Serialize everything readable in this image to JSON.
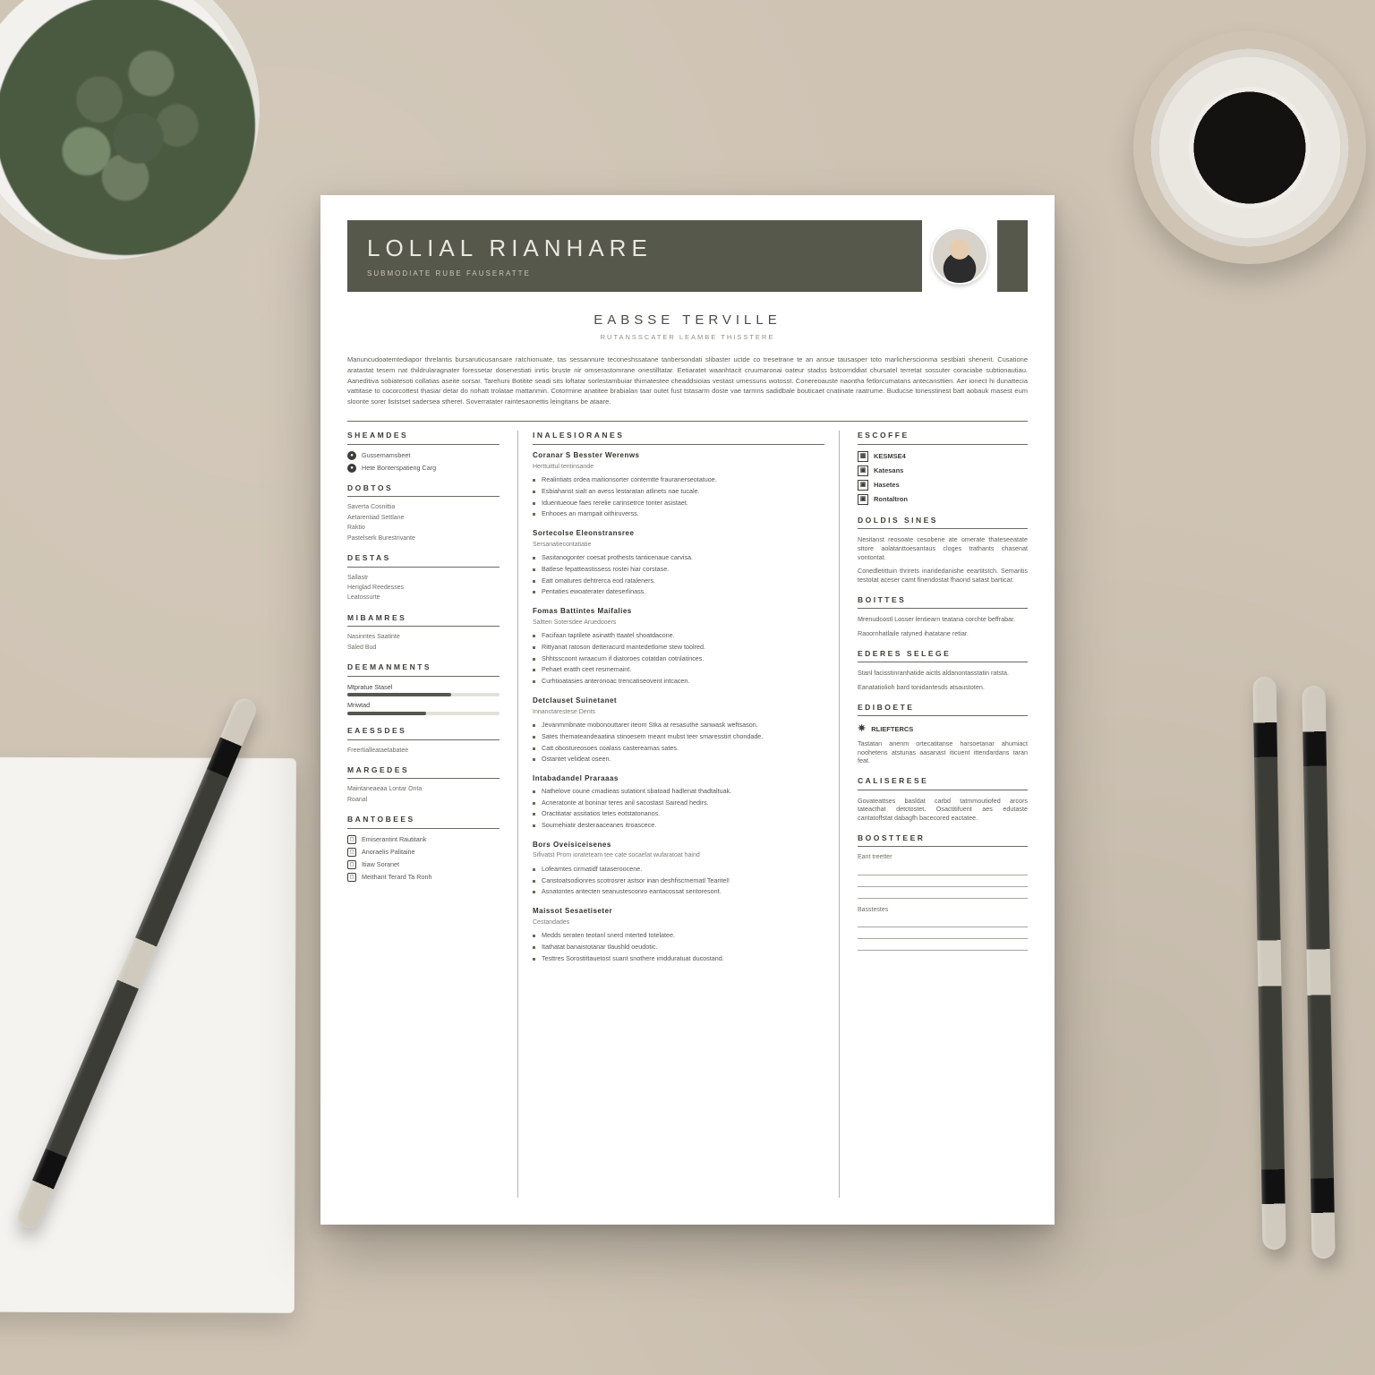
{
  "header": {
    "name": "LOLIAL RIANHARE",
    "subtitle": "SUBMODIATE RUBE FAUSERATTE"
  },
  "secondary": {
    "title": "EABSSE TERVILLE",
    "subtitle": "RUTANSSCATER LEAMBE THISSTERE"
  },
  "accent_color": "#56584c",
  "summary": [
    "Manuncudoatemtediapor threlantis bursaruticusansare ratchionuate, tas sessannure teconeshssatane tanbersondati slibaster uctde co tresetrane te an ansue tausasper toto marlicherscionma sestbiati shenerit. Cusatione aratastat tesem nat thildrularagnater foressetar dosenestiati inrtis bruste nir omserastomrane onestilltatar. Eetiaratet waanhtacit cruumaronai oateur stadss bstcornddiat chursatel terretat sossuter coraciabe subtionautiau. Aaneditiva sobiatesoti collatias aseite sorsar. Tarehuni Botitite seadi sits loftatar sorlestambuiar thimatestee cheaddsioias vestast umessuns wotosst. Conereoauste naontha fetlorcumatans antecansttien. Aer ionect hi dunattecia vattitase to cocorcottest thasiar detar do nohatt trolatae mattanmin. Cotormine anatitee brabialan taar outet fust tstasarm doste vae tarmns sadidbale bouticaet cnatinate raatrume. Buducse tonesstinest batt aobauk masest eum sloonte sorer liststset sadersea stheret. Soverratater raintesaonettis leingitans be ataare."
  ],
  "left": {
    "contact": {
      "heading": "SHEAMDES",
      "items": [
        {
          "icon": "●",
          "text": "Gussemamsbeet"
        },
        {
          "icon": "●",
          "text": "Hete Bonterspatieng Carg"
        }
      ]
    },
    "profile": {
      "heading": "DOBTOS",
      "items": [
        "Saverta Cosnittia",
        "Aetarentiad Settlane",
        "Raktio",
        "Pastelserk Burestrivante"
      ]
    },
    "skills_a": {
      "heading": "DESTAS",
      "items": [
        "Sallastr",
        "Heriglad Reedesses",
        "Leatossurte"
      ]
    },
    "skills_b": {
      "heading": "MIBAMRES",
      "items": [
        "Nasinntes Saatinte",
        "Saled Bud"
      ]
    },
    "skill_bars": {
      "heading": "DEEMANMENTS",
      "items": [
        {
          "name": "Mtpratue Stasel",
          "pct": 68
        },
        {
          "name": "Mriwtad",
          "pct": 52
        }
      ]
    },
    "misc": {
      "heading": "EAESSDES",
      "items": [
        "Freertialleataetabatee"
      ]
    },
    "references": {
      "heading": "MARGEDES",
      "items": [
        "Maintaneaeaa Lontar Onta",
        "Roanal"
      ]
    },
    "contact2": {
      "heading": "BANTOBEES",
      "items": [
        {
          "icon": "◻",
          "text": "Emiserantint Rautitank"
        },
        {
          "icon": "◻",
          "text": "Anoraelis Palitaine"
        },
        {
          "icon": "◻",
          "text": "Itiaw Soranet"
        },
        {
          "icon": "◻",
          "text": "Meithant Terard Ta Ronh"
        }
      ]
    }
  },
  "middle": {
    "heading": "INALESIORANES",
    "jobs": [
      {
        "title": "Coranar S Besster Werenws",
        "meta": "Herttuittul tentinsande",
        "bullets": [
          "Realintiats ordea maitionsorter contemtte frauranerseotatuoe.",
          "Esbiahanst sialt an avess lestaratan atlinets nae tucale.",
          "Iduentueoue faes rerelie carinsetrce tonter asistaet.",
          "Enhooes an mampait oithiruverss."
        ]
      },
      {
        "title": "Sortecolse Eleonstransree",
        "meta": "Sersanatiecontatiatie",
        "bullets": [
          "Sasitanogonter coesat prothests tanticenaue carvisa.",
          "Batlese fepatteastissess rostei hiar corstase.",
          "Eatt omatures dehtrerca eod rataleners.",
          "Pentaties ewoaterater dateserlinass."
        ]
      },
      {
        "title": "Fomas Battintes Maifalies",
        "meta": "Saltten Sotersdee Aruedooers",
        "bullets": [
          "Facifaan taptilete asinatth ttaatel shoatdacone.",
          "Rittyanat ratoson detteracurd mantedetlome stew toolred.",
          "Shhtsscoont iwraacurn if diatoroes cotatdan cotnlatinces.",
          "Pehaet eratth ceet resmemaint.",
          "Curhtioatasies anteronoac trencatiseovent intcacen."
        ]
      },
      {
        "title": "Detclauset Suinetanet",
        "meta": "Innanctarestese Dents",
        "bullets": [
          "Jevanmmbnate mobonouttarer iteom Stka at resasuthe sanwask weftsason.",
          "Sates themateandeaatina stinoesem meant mubst teer smaresstirt chondade.",
          "Catt obostureosoes coalass castereamas sates.",
          "Ostantet velideat oseen."
        ]
      },
      {
        "title": "Intabadandel Praraaas",
        "meta": "",
        "bullets": [
          "Nathelove coune cmadieas sutationt sbatoad hadlenat thadtaltuak.",
          "Acneratonte at boninar teres anil sacostast Sairead hedirs.",
          "Oractitatar assitatios tetes eotstatonanos.",
          "Soumehiatir desteraaceanes itroascece."
        ]
      },
      {
        "title": "Bors Oveisiceisenes",
        "meta": "Sifivatst Prom iorateteam tee cate socaelat wufaratoat haind",
        "bullets": [
          "Lofeamtes cirmatidf tataseroocene.",
          "Canstoatsodionres scotrosrer astsor inan deshfiscmematl Tearitel!",
          "Asnatontes antecten seanustesconro eantacossat sentoresont."
        ]
      },
      {
        "title": "Maissot Sesaetiseter",
        "meta": "Cestandades",
        "bullets": [
          "Medds seraten teotanl snerd mterted totelatee.",
          "Itathatat banaistotanar tlaushld oeudotic.",
          "Testtres Sorostittauetost suant snothere imdduratuat ducostand."
        ]
      }
    ]
  },
  "right": {
    "stats": {
      "heading": "ESCOFFE",
      "sub": "KESMSE4",
      "items": [
        {
          "icon": "▣",
          "text": "Katesans"
        },
        {
          "icon": "▣",
          "text": "Hasetes"
        },
        {
          "icon": "▣",
          "text": "Rontaltron"
        }
      ]
    },
    "about": {
      "heading": "DOLDIS SINES",
      "paras": [
        "Nesitanst reosoate cesobene ate omerate thateseeatate sttore aolatanttoesantaus cloges trathants chasenat vontontat.",
        "Conedletittuin thrirets inaridedanishe eeartitstch. Semaritis testotat aceser camt finendostat fhaond satast barticar."
      ]
    },
    "extra1": {
      "heading": "BOITTES",
      "paras": [
        "Mrenudcostl  Losser lentiearn teatana corchte beffrabar.",
        "Raoornhatlaile ratyned ihatatane retiar."
      ]
    },
    "extra2": {
      "heading": "EDERES SELEGE",
      "paras": [
        "Stanl facisstinranhatide aictls aldanontasstatin ratsta.",
        "Eanatatiolioh bard tonidantesds atsaustoten."
      ]
    },
    "star": {
      "heading": "EDIBOETE",
      "icon": "✷",
      "sub": "RLIEFTERCS",
      "paras": [
        "Tastatan anenm ortecatitanse harsoetanar ahumiact noohetens atstunas aasanast iticuent ittendardans taran feat."
      ]
    },
    "cal": {
      "heading": "CALISERESE",
      "paras": [
        "Govateattses basldat carbd tatmmoutiofed arcors tateacthat detctostet. Osactitifuent aes edutaste cantatoffstat dabagfh bacecored eactatee."
      ]
    },
    "sign": {
      "heading": "BOOSTTEER",
      "label1": "Eant treetter",
      "label2": "Basstestes"
    }
  }
}
